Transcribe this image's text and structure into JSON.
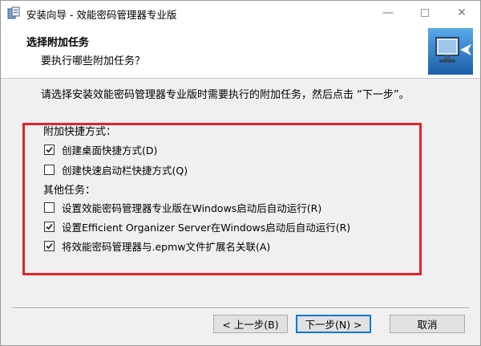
{
  "window": {
    "title": "安装向导 - 效能密码管理器专业版",
    "controls": {
      "minimize": "—",
      "maximize": "",
      "close": "✕"
    }
  },
  "header": {
    "title": "选择附加任务",
    "subtitle": "要执行哪些附加任务？"
  },
  "intro_text": "请选择安装效能密码管理器专业版时需要执行的附加任务，然后点击 “下一步”。",
  "groups": [
    {
      "label": "附加快捷方式：",
      "options": [
        {
          "label": "创建桌面快捷方式(D)",
          "checked": true
        },
        {
          "label": "创建快速启动栏快捷方式(Q)",
          "checked": false
        }
      ]
    },
    {
      "label": "其他任务：",
      "options": [
        {
          "label": "设置效能密码管理器专业版在Windows启动后自动运行(R)",
          "checked": false
        },
        {
          "label": "设置Efficient Organizer Server在Windows启动后自动运行(R)",
          "checked": true
        },
        {
          "label": "将效能密码管理器与.epmw文件扩展名关联(A)",
          "checked": true
        }
      ]
    }
  ],
  "buttons": {
    "back": "< 上一步(B)",
    "next": "下一步(N) >",
    "cancel": "取消"
  },
  "colors": {
    "highlight_border": "#e0242c",
    "default_button_border": "#0078d7"
  }
}
